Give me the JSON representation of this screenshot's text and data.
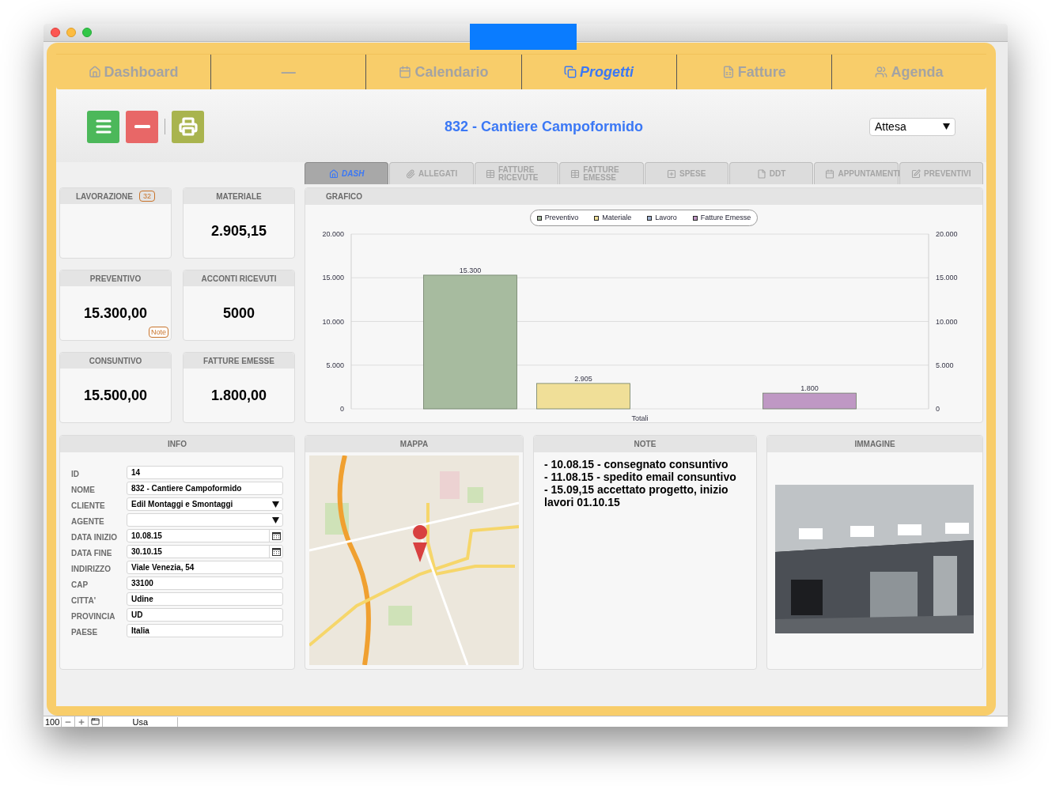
{
  "nav_tabs": [
    {
      "label": "Dashboard",
      "selected": false
    },
    {
      "label": "—",
      "selected": false
    },
    {
      "label": "Calendario",
      "selected": false
    },
    {
      "label": "Progetti",
      "selected": true
    },
    {
      "label": "Fatture",
      "selected": false
    },
    {
      "label": "Agenda",
      "selected": false
    }
  ],
  "toolbar": [
    {
      "kind": "menu"
    },
    {
      "kind": "minus"
    },
    {
      "kind": "print"
    }
  ],
  "title": "832 - Cantiere Campoformido",
  "status_select": {
    "value": "Attesa"
  },
  "sub_tabs": [
    {
      "label": "DASH",
      "selected": true
    },
    {
      "label": "ALLEGATI",
      "selected": false
    },
    {
      "label": "FATTURE RICEVUTE",
      "selected": false
    },
    {
      "label": "FATTURE EMESSE",
      "selected": false
    },
    {
      "label": "SPESE",
      "selected": false
    },
    {
      "label": "DDT",
      "selected": false
    },
    {
      "label": "APPUNTAMENTI",
      "selected": false
    },
    {
      "label": "PREVENTIVI",
      "selected": false
    }
  ],
  "cards": [
    {
      "title": "LAVORAZIONE",
      "badge": "32"
    },
    {
      "title": "MATERIALE",
      "value": "2.905,15"
    },
    {
      "title": "PREVENTIVO",
      "value": "15.300,00",
      "note": "Note"
    },
    {
      "title": "ACCONTI RICEVUTI",
      "value": "5000"
    },
    {
      "title": "CONSUNTIVO",
      "value": "15.500,00"
    },
    {
      "title": "FATTURE EMESSE",
      "value": "1.800,00"
    }
  ],
  "chart_panel": {
    "title": "GRAFICO",
    "chart_data": {
      "type": "bar",
      "xlabel": "Totali",
      "grid": true,
      "legend": true,
      "series": [
        {
          "name": "Preventivo",
          "color": "#a7bb9f",
          "values": [
            15300
          ]
        },
        {
          "name": "Materiale",
          "color": "#f0df98",
          "values": [
            2905
          ]
        },
        {
          "name": "Lavoro",
          "color": "#9fb2cf",
          "values": [
            null
          ]
        },
        {
          "name": "Fatture Emesse",
          "color": "#bf98c4",
          "values": [
            1800
          ]
        }
      ],
      "ylim": [
        0,
        20000
      ],
      "yticks": [
        {
          "value": 0,
          "label": "0"
        },
        {
          "value": 5000,
          "label": "5.000"
        },
        {
          "value": 10000,
          "label": "10.000"
        },
        {
          "value": 15000,
          "label": "15.000"
        },
        {
          "value": 20000,
          "label": "20.000"
        }
      ],
      "value_labels": [
        "15.300",
        "2.905",
        null,
        "1.800"
      ]
    }
  },
  "info": {
    "title": "INFO",
    "fields": [
      {
        "label": "ID",
        "value": "14",
        "kind": "text"
      },
      {
        "label": "NOME",
        "value": "832 - Cantiere Campoformido",
        "kind": "text"
      },
      {
        "label": "CLIENTE",
        "value": "Edil Montaggi e Smontaggi",
        "kind": "select"
      },
      {
        "label": "AGENTE",
        "kind": "select"
      },
      {
        "label": "DATA INIZIO",
        "value": "10.08.15",
        "kind": "date"
      },
      {
        "label": "DATA FINE",
        "value": "30.10.15",
        "kind": "date"
      },
      {
        "label": "INDIRIZZO",
        "value": "Viale Venezia, 54",
        "kind": "text"
      },
      {
        "label": "CAP",
        "value": "33100",
        "kind": "text"
      },
      {
        "label": "CITTA'",
        "value": "Udine",
        "kind": "text"
      },
      {
        "label": "PROVINCIA",
        "value": "UD",
        "kind": "text"
      },
      {
        "label": "PAESE",
        "value": "Italia",
        "kind": "text"
      }
    ]
  },
  "map": {
    "title": "MAPPA",
    "kind": "picture"
  },
  "note": {
    "title": "NOTE",
    "lines": [
      "- 10.08.15 - consegnato consuntivo",
      "- 11.08.15 - spedito email consuntivo",
      "- 15.09,15 accettato progetto, inizio lavori 01.10.15"
    ]
  },
  "image": {
    "title": "IMMAGINE",
    "kind": "picture"
  },
  "status_bar": {
    "zoom": "100",
    "mode": "Usa"
  }
}
